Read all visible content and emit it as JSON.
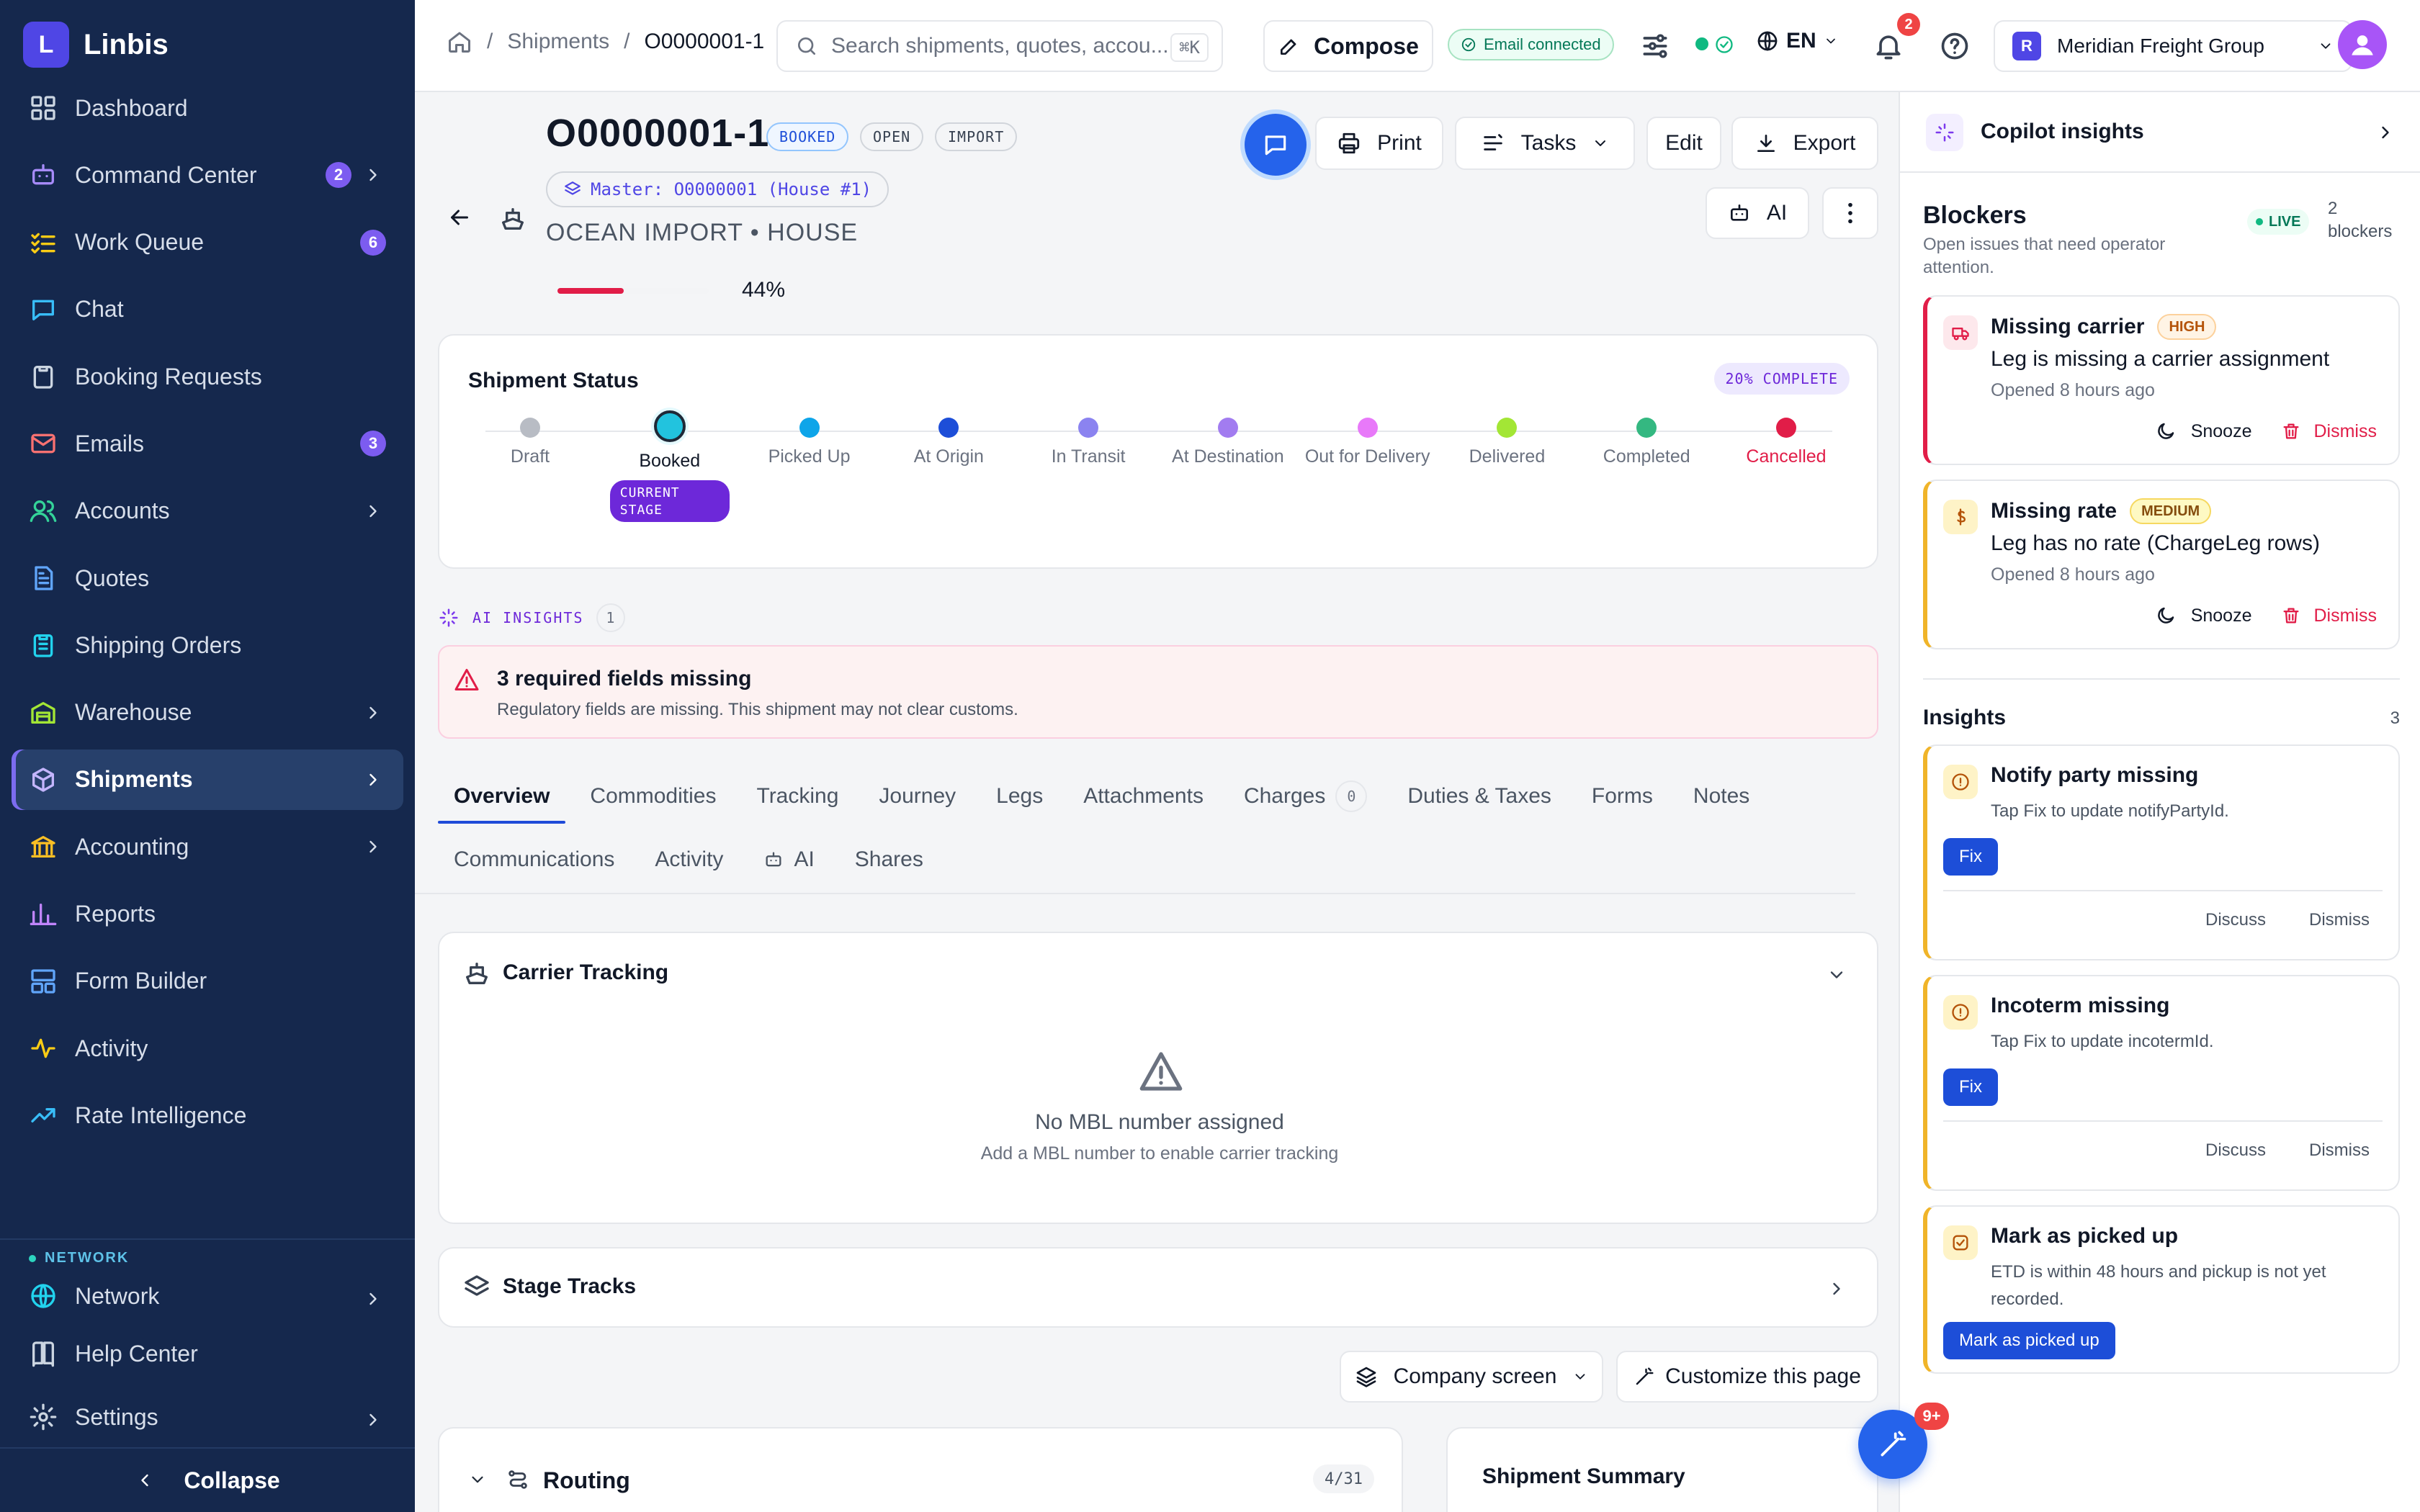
{
  "app": {
    "name": "Linbis",
    "logo_letter": "L"
  },
  "sidebar": {
    "items": [
      {
        "label": "Dashboard",
        "icon": "dashboard-icon"
      },
      {
        "label": "Command Center",
        "icon": "robot-icon",
        "badge": "2",
        "chevron": true
      },
      {
        "label": "Work Queue",
        "icon": "checklist-icon",
        "badge": "6"
      },
      {
        "label": "Chat",
        "icon": "chat-icon"
      },
      {
        "label": "Booking Requests",
        "icon": "clipboard-icon"
      },
      {
        "label": "Emails",
        "icon": "mail-icon",
        "badge": "3"
      },
      {
        "label": "Accounts",
        "icon": "users-icon",
        "chevron": true
      },
      {
        "label": "Quotes",
        "icon": "document-icon"
      },
      {
        "label": "Shipping Orders",
        "icon": "clipboard-list-icon"
      },
      {
        "label": "Warehouse",
        "icon": "warehouse-icon",
        "chevron": true
      },
      {
        "label": "Shipments",
        "icon": "package-icon",
        "chevron": true,
        "active": true
      },
      {
        "label": "Accounting",
        "icon": "bank-icon",
        "chevron": true
      },
      {
        "label": "Reports",
        "icon": "bar-chart-icon"
      },
      {
        "label": "Form Builder",
        "icon": "layout-icon"
      },
      {
        "label": "Activity",
        "icon": "activity-icon"
      },
      {
        "label": "Rate Intelligence",
        "icon": "trending-up-icon"
      }
    ],
    "network_label": "NETWORK",
    "network_items": [
      {
        "label": "Network",
        "icon": "globe-icon",
        "chevron": true
      },
      {
        "label": "Help Center",
        "icon": "book-icon"
      },
      {
        "label": "Settings",
        "icon": "gear-icon",
        "chevron": true
      }
    ],
    "collapse_label": "Collapse"
  },
  "topbar": {
    "breadcrumb": [
      "Shipments",
      "O0000001-1"
    ],
    "search_placeholder": "Search shipments, quotes, accou...",
    "search_shortcut": "⌘K",
    "compose_label": "Compose",
    "email_status": "Email connected",
    "language": "EN",
    "notification_count": "2",
    "org_name": "Meridian Freight Group",
    "org_initial": "R"
  },
  "shipment": {
    "number": "O0000001-1",
    "tags": [
      "BOOKED",
      "OPEN",
      "IMPORT"
    ],
    "master": "Master: O0000001 (House #1)",
    "type_line": "OCEAN IMPORT • HOUSE",
    "progress_pct": 44,
    "progress_label": "44%",
    "actions": {
      "print": "Print",
      "tasks": "Tasks",
      "edit": "Edit",
      "export": "Export",
      "ai": "AI"
    }
  },
  "status": {
    "title": "Shipment Status",
    "complete_label": "20% COMPLETE",
    "current_label": "CURRENT STAGE",
    "stages": [
      {
        "label": "Draft",
        "color": "#b8bcc4"
      },
      {
        "label": "Booked",
        "color": "#22c3de",
        "current": true
      },
      {
        "label": "Picked Up",
        "color": "#0ea5e9"
      },
      {
        "label": "At Origin",
        "color": "#1d4ed8"
      },
      {
        "label": "In Transit",
        "color": "#8b83f0"
      },
      {
        "label": "At Destination",
        "color": "#a27cf0"
      },
      {
        "label": "Out for Delivery",
        "color": "#e879f9"
      },
      {
        "label": "Delivered",
        "color": "#a3e635"
      },
      {
        "label": "Completed",
        "color": "#34b881"
      },
      {
        "label": "Cancelled",
        "color": "#e11d48",
        "text_color": "#e11d48"
      }
    ]
  },
  "ai_insights": {
    "label": "AI INSIGHTS",
    "count": "1",
    "alert_title": "3 required fields missing",
    "alert_body": "Regulatory fields are missing. This shipment may not clear customs."
  },
  "tabs": {
    "row1": [
      {
        "label": "Overview",
        "active": true
      },
      {
        "label": "Commodities"
      },
      {
        "label": "Tracking"
      },
      {
        "label": "Journey"
      },
      {
        "label": "Legs"
      },
      {
        "label": "Attachments"
      },
      {
        "label": "Charges",
        "count": "0"
      },
      {
        "label": "Duties & Taxes"
      },
      {
        "label": "Forms"
      },
      {
        "label": "Notes"
      }
    ],
    "row2": [
      {
        "label": "Communications"
      },
      {
        "label": "Activity"
      },
      {
        "label": "AI",
        "icon": "robot-icon"
      },
      {
        "label": "Shares"
      }
    ]
  },
  "carrier_tracking": {
    "title": "Carrier Tracking",
    "empty_title": "No MBL number assigned",
    "empty_sub": "Add a MBL number to enable carrier tracking"
  },
  "stage_tracks": {
    "title": "Stage Tracks"
  },
  "layout_controls": {
    "company_screen": "Company screen",
    "customize": "Customize this page"
  },
  "routing": {
    "title": "Routing",
    "count": "4/31"
  },
  "summary": {
    "title": "Shipment Summary"
  },
  "copilot": {
    "title": "Copilot insights",
    "blockers_title": "Blockers",
    "blockers_sub": "Open issues that need operator attention.",
    "live_label": "LIVE",
    "blockers_count": "2",
    "blockers_word": "blockers",
    "blockers": [
      {
        "title": "Missing carrier",
        "severity": "HIGH",
        "body": "Leg is missing a carrier assignment",
        "meta": "Opened 8 hours ago",
        "snooze": "Snooze",
        "dismiss": "Dismiss"
      },
      {
        "title": "Missing rate",
        "severity": "MEDIUM",
        "body": "Leg has no rate (ChargeLeg rows)",
        "meta": "Opened 8 hours ago",
        "snooze": "Snooze",
        "dismiss": "Dismiss"
      }
    ],
    "insights_title": "Insights",
    "insights_count": "3",
    "insights": [
      {
        "title": "Notify party missing",
        "body": "Tap Fix to update notifyPartyId.",
        "action": "Fix",
        "discuss": "Discuss",
        "dismiss": "Dismiss"
      },
      {
        "title": "Incoterm missing",
        "body": "Tap Fix to update incotermId.",
        "action": "Fix",
        "discuss": "Discuss",
        "dismiss": "Dismiss"
      },
      {
        "title": "Mark as picked up",
        "body": "ETD is within 48 hours and pickup is not yet recorded.",
        "action": "Mark as picked up"
      }
    ],
    "fab_badge": "9+"
  }
}
